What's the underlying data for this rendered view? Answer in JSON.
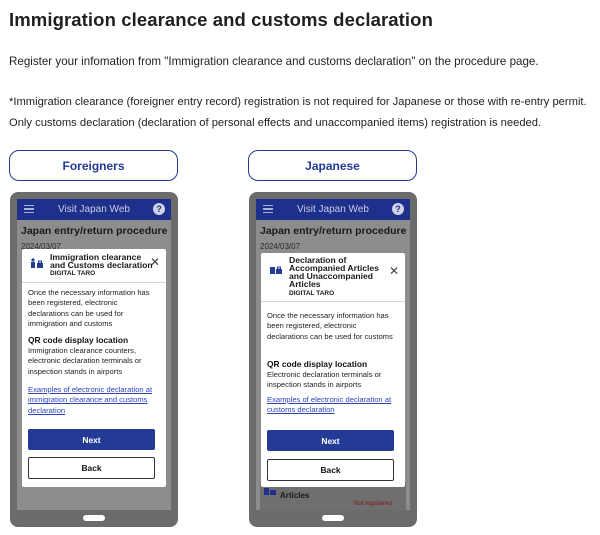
{
  "page": {
    "title": "Immigration clearance and customs declaration",
    "intro": "Register your infomation from \"Immigration clearance and customs declaration\" on the procedure page.",
    "note_line1": "*Immigration clearance (foreigner entry record) registration is not required for Japanese or those with re-entry permit.",
    "note_line2": "Only customs declaration (declaration of personal effects and unaccompanied items) registration is needed."
  },
  "columns": {
    "foreigners_label": "Foreigners",
    "japanese_label": "Japanese"
  },
  "phone_common": {
    "app_title": "Visit Japan Web",
    "screen_title": "Japan entry/return procedure",
    "date": "2024/03/07",
    "user_name": "DIGITAL TARO",
    "next_label": "Next",
    "back_label": "Back"
  },
  "foreigners_modal": {
    "title_line1": "Immigration clearance",
    "title_line2": "and Customs declaration",
    "body": "Once the necessary information has been registered, electronic declarations can be used for immigration and customs",
    "qr_heading": "QR code display location",
    "qr_body": "Immigration clearance counters, electronic declaration terminals or inspection stands in airports",
    "link": "Examples of electronic declaration at immigration clearance and customs declaration"
  },
  "japanese_modal": {
    "title_line1": "Declaration of",
    "title_line2": "Accompanied Articles",
    "title_line3": "and Unaccompanied",
    "title_line4": "Articles",
    "body": "Once the necessary information has been registered, electronic declarations can be used for customs",
    "qr_heading": "QR code display location",
    "qr_body": "Electronic declaration terminals or inspection stands in airports",
    "link": "Examples of electronic declaration at customs declaration",
    "peek_label": "Articles",
    "peek_status": "Not registered"
  },
  "colors": {
    "brand": "#233a97",
    "app_bar": "#1f2f8c",
    "link": "#2a46b8",
    "status_red": "#7a1616"
  },
  "icons": {
    "menu": "hamburger-menu-icon",
    "help": "help-icon",
    "close": "close-icon",
    "immigration": "immigration-customs-icon",
    "declaration": "declaration-articles-icon"
  }
}
